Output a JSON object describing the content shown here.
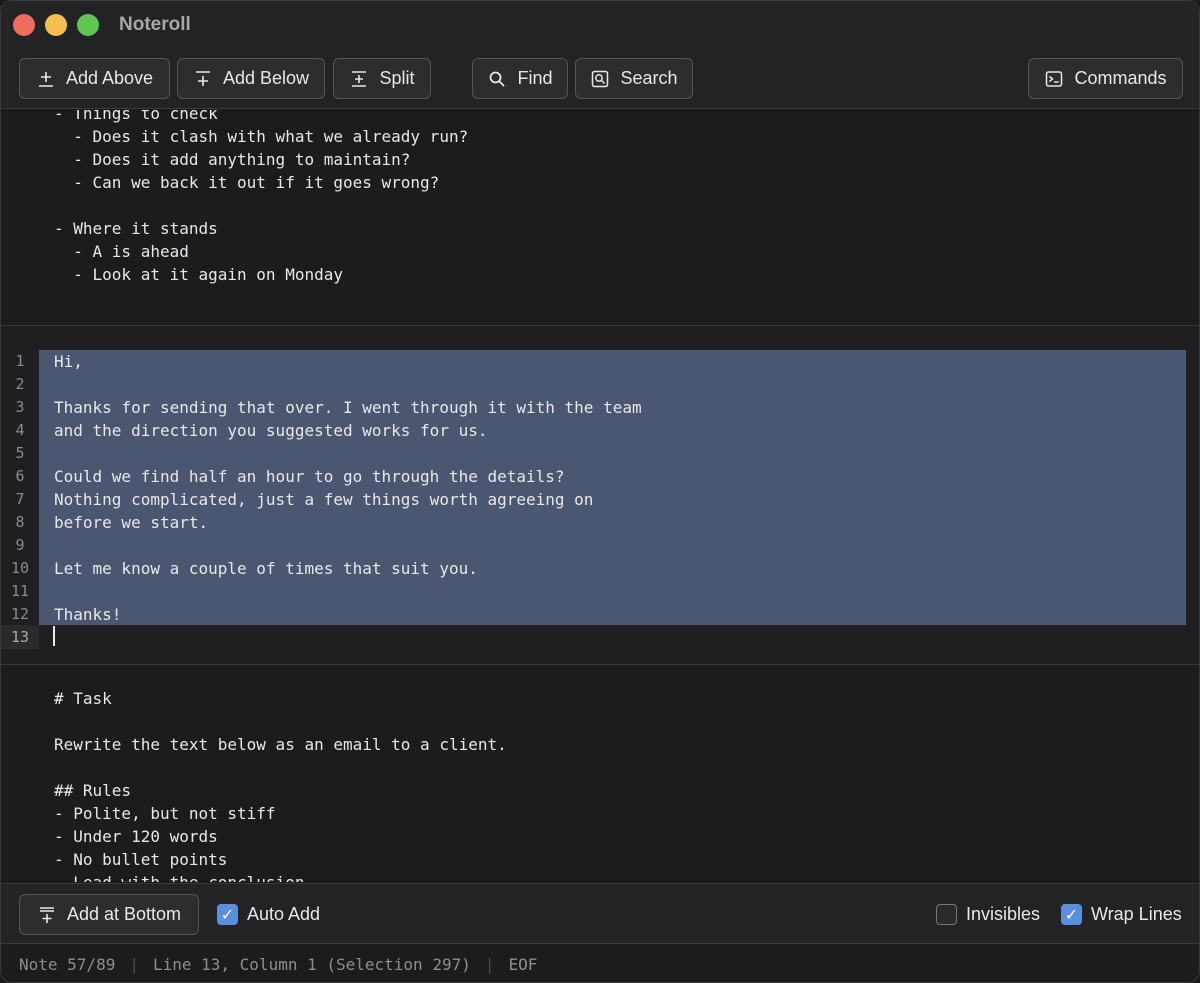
{
  "app": {
    "title": "Noteroll"
  },
  "toolbar": {
    "add_above": "Add Above",
    "add_below": "Add Below",
    "split": "Split",
    "find": "Find",
    "search": "Search",
    "commands": "Commands"
  },
  "pane_top": {
    "lines": [
      "- Things to check",
      "  - Does it clash with what we already run?",
      "  - Does it add anything to maintain?",
      "  - Can we back it out if it goes wrong?",
      "",
      "- Where it stands",
      "  - A is ahead",
      "  - Look at it again on Monday"
    ]
  },
  "pane_mid": {
    "line_numbers": [
      "1",
      "2",
      "3",
      "4",
      "5",
      "6",
      "7",
      "8",
      "9",
      "10",
      "11",
      "12",
      "13"
    ],
    "current_line": 13,
    "lines": [
      "Hi,",
      "",
      "Thanks for sending that over. I went through it with the team",
      "and the direction you suggested works for us.",
      "",
      "Could we find half an hour to go through the details?",
      "Nothing complicated, just a few things worth agreeing on",
      "before we start.",
      "",
      "Let me know a couple of times that suit you.",
      "",
      "Thanks!"
    ]
  },
  "pane_bot": {
    "lines": [
      "# Task",
      "",
      "Rewrite the text below as an email to a client.",
      "",
      "## Rules",
      "- Polite, but not stiff",
      "- Under 120 words",
      "- No bullet points",
      "- Lead with the conclusion"
    ]
  },
  "bottombar": {
    "add_at_bottom": "Add at Bottom",
    "auto_add": {
      "label": "Auto Add",
      "checked": true
    },
    "invisibles": {
      "label": "Invisibles",
      "checked": false
    },
    "wrap_lines": {
      "label": "Wrap Lines",
      "checked": true
    }
  },
  "status": {
    "note": "Note 57/89",
    "position": "Line 13, Column 1 (Selection 297)",
    "eof": "EOF"
  },
  "colors": {
    "selection": "#4b5670",
    "checkbox_on": "#5a8fe0",
    "close": "#ed6a5e",
    "minimize": "#f5bf4f",
    "zoom": "#61c554"
  },
  "icons": {
    "add_above": "plus-above-icon",
    "add_below": "plus-below-icon",
    "split": "split-icon",
    "find": "magnifier-icon",
    "search": "search-box-icon",
    "commands": "terminal-icon",
    "add_at_bottom": "plus-bottom-icon"
  }
}
